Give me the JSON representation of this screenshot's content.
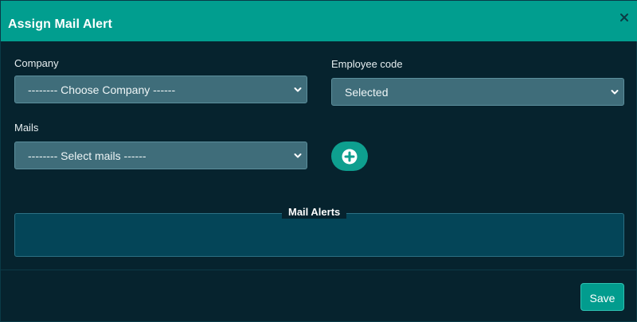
{
  "modal": {
    "title": "Assign Mail Alert",
    "close_icon": "close-icon"
  },
  "form": {
    "company": {
      "label": "Company",
      "value": "-------- Choose Company ------"
    },
    "employee_code": {
      "label": "Employee code",
      "value": "Selected"
    },
    "mails": {
      "label": "Mails",
      "value": "-------- Select mails ------"
    },
    "add_icon": "plus-circle-icon"
  },
  "mail_alerts": {
    "legend": "Mail Alerts"
  },
  "footer": {
    "save_label": "Save"
  },
  "colors": {
    "header": "#019e8f",
    "background": "#06232e",
    "select_bg": "#3f6d7a",
    "fieldset_bg": "#044558",
    "accent": "#029c8e"
  }
}
